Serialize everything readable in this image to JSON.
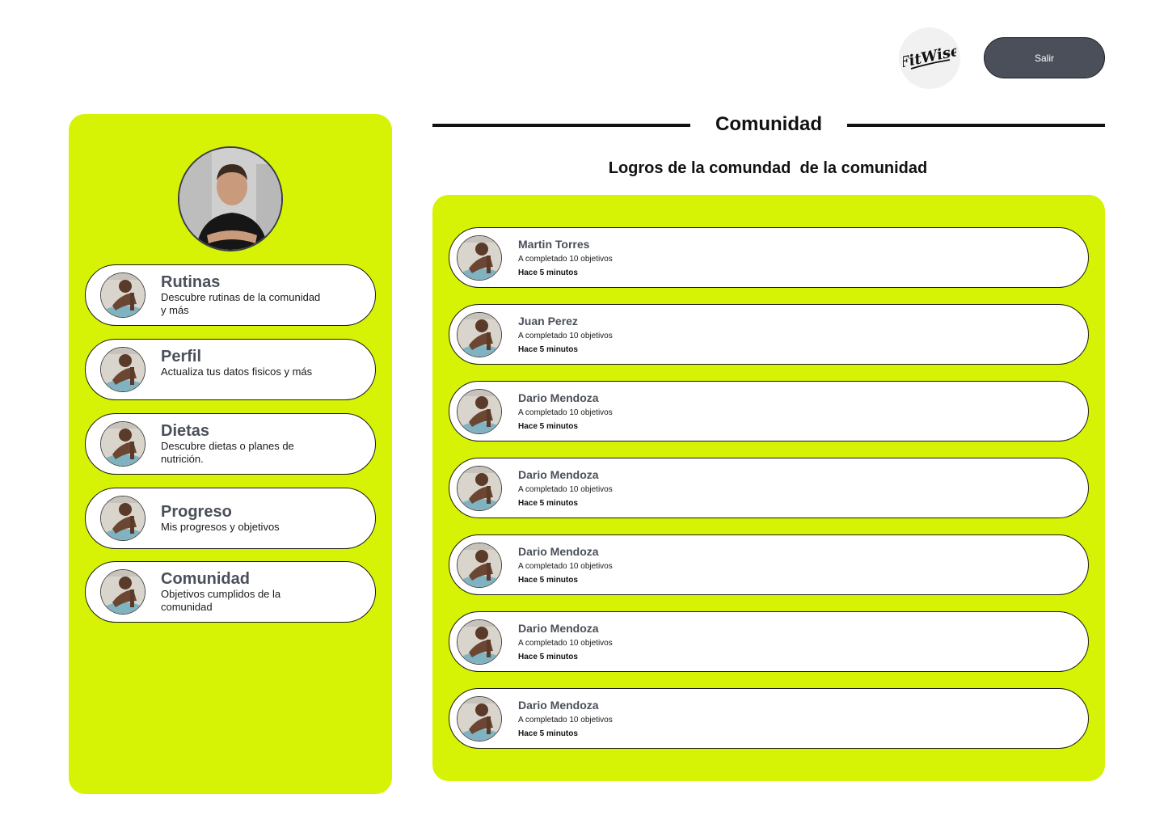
{
  "header": {
    "logo_text": "FitWise",
    "logout_label": "Salir"
  },
  "sidebar": {
    "items": [
      {
        "title": "Rutinas",
        "desc": "Descubre rutinas de la comunidad y más"
      },
      {
        "title": "Perfil",
        "desc": "Actualiza tus datos fisicos y más"
      },
      {
        "title": "Dietas",
        "desc": "Descubre dietas o planes de nutrición."
      },
      {
        "title": "Progreso",
        "desc": "Mis progresos y objetivos"
      },
      {
        "title": "Comunidad",
        "desc": "Objetivos cumplidos de la comunidad"
      }
    ]
  },
  "main": {
    "title": "Comunidad",
    "subtitle": "Logros de la comundad  de la comunidad",
    "feed": [
      {
        "name": "Martin Torres",
        "desc": "A completado 10 objetivos",
        "time": "Hace 5 minutos"
      },
      {
        "name": "Juan Perez",
        "desc": "A completado 10 objetivos",
        "time": "Hace 5 minutos"
      },
      {
        "name": "Dario Mendoza",
        "desc": "A completado 10 objetivos",
        "time": "Hace 5 minutos"
      },
      {
        "name": "Dario Mendoza",
        "desc": "A completado 10 objetivos",
        "time": "Hace 5 minutos"
      },
      {
        "name": "Dario Mendoza",
        "desc": "A completado 10 objetivos",
        "time": "Hace 5 minutos"
      },
      {
        "name": "Dario Mendoza",
        "desc": "A completado 10 objetivos",
        "time": "Hace 5 minutos"
      },
      {
        "name": "Dario Mendoza",
        "desc": "A completado 10 objetivos",
        "time": "Hace 5 minutos"
      }
    ]
  },
  "colors": {
    "accent": "#d6f205",
    "dark_button": "#4a4f5a"
  }
}
